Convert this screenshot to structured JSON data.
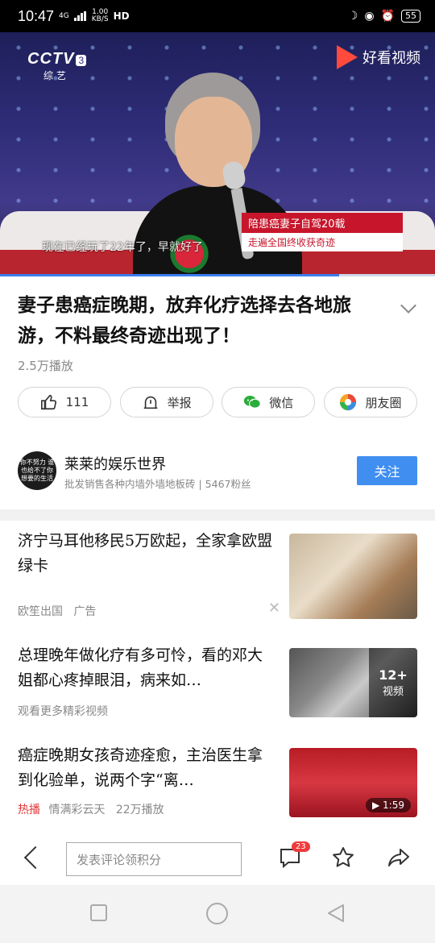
{
  "status_bar": {
    "time": "10:47",
    "network_type": "4G",
    "speed": "1.00",
    "speed_unit": "KB/S",
    "hd": "HD",
    "battery": "55"
  },
  "video": {
    "channel_logo": "CCTV",
    "channel_number": "3",
    "channel_sub": "综艺",
    "app_brand": "好看视频",
    "caption_line1": "陪患癌妻子自驾20载",
    "caption_line2": "走遍全国终收获奇迹",
    "subtitle": "现在已经玩了22年了，早就好了",
    "progress_fraction": 0.78
  },
  "article": {
    "title": "妻子患癌症晚期，放弃化疗选择去各地旅游，不料最终奇迹出现了！",
    "views": "2.5万播放"
  },
  "actions": {
    "like_count": "111",
    "report_label": "举报",
    "wechat_label": "微信",
    "moments_label": "朋友圈"
  },
  "author": {
    "avatar_text": "你不努力 谁也给不了你 想要的生活",
    "name": "莱莱的娱乐世界",
    "description": "批发销售各种内墙外墙地板砖 | 5467粉丝",
    "follow_label": "关注"
  },
  "feed": [
    {
      "title": "济宁马耳他移民5万欧起，全家拿欧盟绿卡",
      "source": "欧笙出国",
      "tag": "广告"
    },
    {
      "title": "总理晚年做化疗有多可怜，看的邓大姐都心疼掉眼泪，病来如…",
      "meta": "观看更多精彩视频",
      "overlay_count": "12+",
      "overlay_label": "视频"
    },
    {
      "title": "癌症晚期女孩奇迹痊愈，主治医生拿到化验单，说两个字“离…",
      "hot_label": "热播",
      "source": "情满彩云天",
      "views": "22万播放",
      "duration": "1:59"
    }
  ],
  "bottom_bar": {
    "comment_placeholder": "发表评论领积分",
    "comment_badge": "23"
  },
  "colors": {
    "accent": "#3f8ef0",
    "hot": "#e33a3a",
    "badge": "#ee3b3b"
  }
}
